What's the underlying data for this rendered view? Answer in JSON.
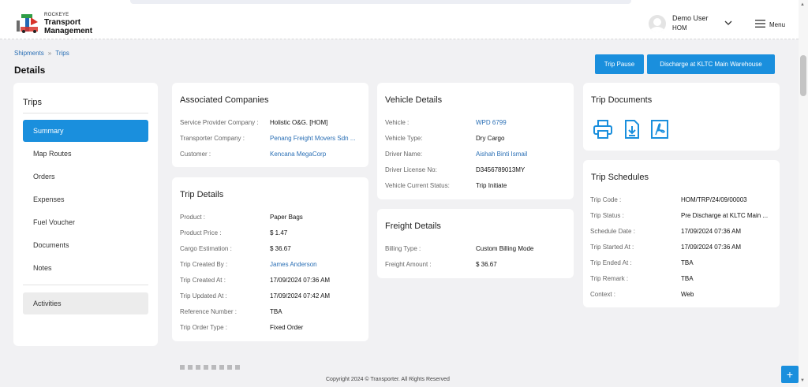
{
  "brand": {
    "small": "ROCKEYE",
    "line1": "Transport",
    "line2": "Management",
    "colors": {
      "red": "#d8332a",
      "green": "#2f9e46",
      "blue": "#2468b5",
      "grey": "#6b6b6b"
    }
  },
  "user": {
    "name": "Demo User",
    "role": "HOM"
  },
  "menu": {
    "label": "Menu"
  },
  "breadcrumb": {
    "parent": "Shipments",
    "separator": "»",
    "current": "Trips"
  },
  "page_title": "Details",
  "actions": {
    "pause": "Trip Pause",
    "discharge": "Discharge at KLTC Main Warehouse"
  },
  "sidebar": {
    "title": "Trips",
    "items": [
      {
        "label": "Summary"
      },
      {
        "label": "Map Routes"
      },
      {
        "label": "Orders"
      },
      {
        "label": "Expenses"
      },
      {
        "label": "Fuel Voucher"
      },
      {
        "label": "Documents"
      },
      {
        "label": "Notes"
      }
    ],
    "activities": "Activities"
  },
  "associated": {
    "title": "Associated Companies",
    "rows": [
      {
        "label": "Service Provider Company :",
        "value": "Holistic O&G. [HOM]"
      },
      {
        "label": "Transporter Company :",
        "value": "Penang Freight Movers Sdn ..."
      },
      {
        "label": "Customer :",
        "value": "Kencana MegaCorp"
      }
    ]
  },
  "trip_details": {
    "title": "Trip Details",
    "rows": [
      {
        "label": "Product :",
        "value": "Paper Bags"
      },
      {
        "label": "Product Price :",
        "value": "$ 1.47"
      },
      {
        "label": "Cargo Estimation :",
        "value": "$ 36.67"
      },
      {
        "label": "Trip Created By :",
        "value": "James Anderson"
      },
      {
        "label": "Trip Created At :",
        "value": "17/09/2024 07:36 AM"
      },
      {
        "label": "Trip Updated At :",
        "value": "17/09/2024 07:42 AM"
      },
      {
        "label": "Reference Number :",
        "value": "TBA"
      },
      {
        "label": "Trip Order Type :",
        "value": "Fixed Order"
      }
    ]
  },
  "vehicle": {
    "title": "Vehicle Details",
    "rows": [
      {
        "label": "Vehicle :",
        "value": "WPD 6799"
      },
      {
        "label": "Vehicle Type:",
        "value": "Dry Cargo"
      },
      {
        "label": "Driver Name:",
        "value": "Aishah Binti Ismail"
      },
      {
        "label": "Driver License No:",
        "value": "D3456789013MY"
      },
      {
        "label": "Vehicle Current Status:",
        "value": "Trip Initiate"
      }
    ]
  },
  "freight": {
    "title": "Freight Details",
    "rows": [
      {
        "label": "Billing Type :",
        "value": "Custom Billing Mode"
      },
      {
        "label": "Freight Amount :",
        "value": "$ 36.67"
      }
    ]
  },
  "documents": {
    "title": "Trip Documents",
    "icons": [
      "printer-icon",
      "download-icon",
      "pdf-icon"
    ]
  },
  "schedules": {
    "title": "Trip Schedules",
    "rows": [
      {
        "label": "Trip Code :",
        "value": "HOM/TRP/24/09/00003"
      },
      {
        "label": "Trip Status :",
        "value": "Pre Discharge at KLTC Main ..."
      },
      {
        "label": "Schedule Date :",
        "value": "17/09/2024 07:36 AM"
      },
      {
        "label": "Trip Started At :",
        "value": "17/09/2024 07:36 AM"
      },
      {
        "label": "Trip Ended At :",
        "value": "TBA"
      },
      {
        "label": "Trip Remark :",
        "value": "TBA"
      },
      {
        "label": "Context :",
        "value": "Web"
      }
    ]
  },
  "footer": "Copyright 2024 © Transporter. All Rights Reserved",
  "fab": "+",
  "scroll": {
    "up": "▲",
    "down": "▼"
  },
  "theme": {
    "accent": "#1a8fdd",
    "link": "#2a6fb5",
    "background": "#f1f1f3"
  }
}
